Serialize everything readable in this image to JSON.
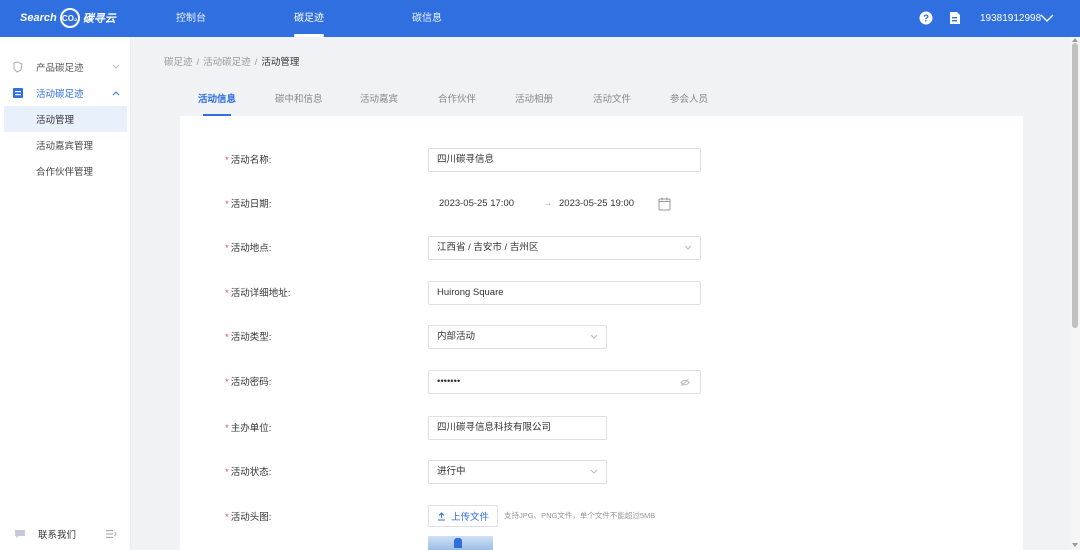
{
  "header": {
    "logo_text": "Search",
    "logo_co2": "CO₂",
    "logo_brand": "碳寻云",
    "nav": [
      {
        "label": "控制台",
        "active": false
      },
      {
        "label": "碳足迹",
        "active": true
      },
      {
        "label": "碳信息",
        "active": false
      }
    ],
    "help_icon": "question-circle-icon",
    "doc_icon": "document-icon",
    "user_phone": "19381912998",
    "colors": {
      "primary": "#2f6fe0",
      "required": "#e34d59"
    }
  },
  "sidebar": {
    "items": [
      {
        "label": "产品碳足迹",
        "icon": "product-icon",
        "expanded": false
      },
      {
        "label": "活动碳足迹",
        "icon": "activity-icon",
        "expanded": true
      }
    ],
    "sub_items": [
      {
        "label": "活动管理",
        "selected": true
      },
      {
        "label": "活动嘉宾管理",
        "selected": false
      },
      {
        "label": "合作伙伴管理",
        "selected": false
      }
    ],
    "contact_label": "联系我们"
  },
  "breadcrumb": {
    "items": [
      "碳足迹",
      "活动碳足迹",
      "活动管理"
    ],
    "separator": "/"
  },
  "tabs": [
    {
      "label": "活动信息",
      "active": true
    },
    {
      "label": "碳中和信息",
      "active": false
    },
    {
      "label": "活动嘉宾",
      "active": false
    },
    {
      "label": "合作伙伴",
      "active": false
    },
    {
      "label": "活动相册",
      "active": false
    },
    {
      "label": "活动文件",
      "active": false
    },
    {
      "label": "参会人员",
      "active": false
    }
  ],
  "form": {
    "name": {
      "label": "活动名称:",
      "value": "四川碳寻信息"
    },
    "date": {
      "label": "活动日期:",
      "start": "2023-05-25 17:00",
      "arrow": "→",
      "end": "2023-05-25 19:00"
    },
    "location": {
      "label": "活动地点:",
      "value": "江西省 / 吉安市 / 吉州区"
    },
    "address": {
      "label": "活动详细地址:",
      "value": "Huirong Square"
    },
    "type": {
      "label": "活动类型:",
      "value": "内部活动"
    },
    "password": {
      "label": "活动密码:",
      "value": "•••••••"
    },
    "organizer": {
      "label": "主办单位:",
      "value": "四川碳寻信息科技有限公司"
    },
    "status": {
      "label": "活动状态:",
      "value": "进行中"
    },
    "cover": {
      "label": "活动头图:",
      "upload_label": "上传文件",
      "hint": "支持JPG、PNG文件，单个文件不能超过5MB"
    }
  }
}
